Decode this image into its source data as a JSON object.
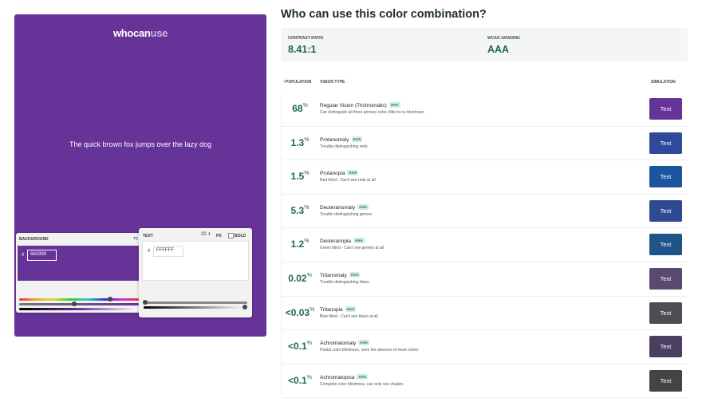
{
  "preview": {
    "logo_dark": "whocan",
    "logo_light": "use",
    "sample_text": "The quick brown fox jumps over the lazy dog",
    "bg_color": "#663399"
  },
  "background_panel": {
    "label": "BACKGROUND",
    "hash": "#",
    "hex": "663399",
    "swap_icon": "swap-icon"
  },
  "text_panel": {
    "label": "TEXT",
    "size": "20",
    "unit": "PX",
    "bold_label": "BOLD",
    "hash": "#",
    "hex": "FFFFFF"
  },
  "header": {
    "title": "Who can use this color combination?"
  },
  "summary": {
    "contrast_label": "CONTRAST RATIO",
    "contrast_value": "8.41:1",
    "wcag_label": "WCAG GRADING",
    "wcag_value": "AAA"
  },
  "columns": {
    "population": "~POPULATION",
    "vision_type": "VISION TYPE",
    "simulation": "SIMULATION"
  },
  "rows": [
    {
      "pct": "68",
      "sym": "%",
      "name": "Regular Vision (Trichromatic)",
      "badge": "AAA",
      "desc": "Can distinguish all three primary color, little to no blurriness",
      "sim_label": "Text",
      "sim_color": "#663399"
    },
    {
      "pct": "1.3",
      "sym": "%",
      "name": "Protanomaly",
      "badge": "AAA",
      "desc": "Trouble distinguishing reds",
      "sim_label": "Text",
      "sim_color": "#2f4a9a"
    },
    {
      "pct": "1.5",
      "sym": "%",
      "name": "Protanopia",
      "badge": "AAA",
      "desc": "Red blind - Can't see reds at all",
      "sim_label": "Text",
      "sim_color": "#1b55a0"
    },
    {
      "pct": "5.3",
      "sym": "%",
      "name": "Deuteranomaly",
      "badge": "AAA",
      "desc": "Trouble distinguishing greens",
      "sim_label": "Text",
      "sim_color": "#2e4b92"
    },
    {
      "pct": "1.2",
      "sym": "%",
      "name": "Deuteranopia",
      "badge": "AAA",
      "desc": "Green blind - Can't see greens at all",
      "sim_label": "Text",
      "sim_color": "#1f5488"
    },
    {
      "pct": "0.02",
      "sym": "%",
      "name": "Tritanomaly",
      "badge": "AAA",
      "desc": "Trouble distinguishing blues",
      "sim_label": "Text",
      "sim_color": "#584a6e"
    },
    {
      "pct": "<0.03",
      "sym": "%",
      "name": "Tritanopia",
      "badge": "AAA",
      "desc": "Blue blind - Can't see blues at all",
      "sim_label": "Text",
      "sim_color": "#4d4d53"
    },
    {
      "pct": "<0.1",
      "sym": "%",
      "name": "Achromatomaly",
      "badge": "AAA",
      "desc": "Partial color blindness, sees the absence of most colors",
      "sim_label": "Text",
      "sim_color": "#4a3f60"
    },
    {
      "pct": "<0.1",
      "sym": "%",
      "name": "Achromatopsia",
      "badge": "AAA",
      "desc": "Complete color blindness, can only see shades",
      "sim_label": "Text",
      "sim_color": "#444444"
    }
  ]
}
